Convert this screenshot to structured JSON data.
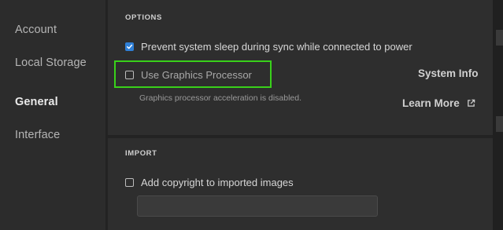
{
  "sidebar": {
    "items": [
      {
        "label": "Account"
      },
      {
        "label": "Local Storage"
      },
      {
        "label": "General",
        "active": true
      },
      {
        "label": "Interface"
      }
    ]
  },
  "options": {
    "title": "OPTIONS",
    "prevent_sleep": {
      "label": "Prevent system sleep during sync while connected to power",
      "checked": true
    },
    "graphics_processor": {
      "label": "Use Graphics Processor",
      "checked": false
    },
    "hint": "Graphics processor acceleration is disabled.",
    "system_info_label": "System Info",
    "learn_more_label": "Learn More"
  },
  "import": {
    "title": "IMPORT",
    "add_copyright": {
      "label": "Add copyright to imported images",
      "checked": false
    },
    "copyright_value": ""
  },
  "colors": {
    "accent": "#2f7fd6",
    "highlight": "#39d11a"
  }
}
